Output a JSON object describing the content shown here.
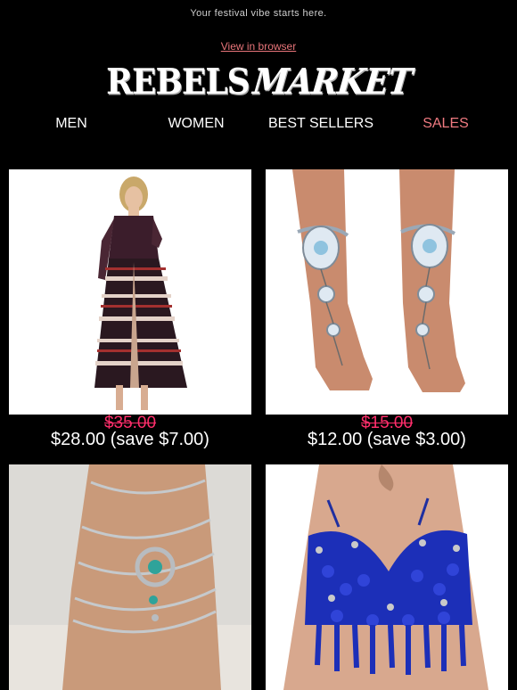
{
  "header": {
    "preheader": "Your festival vibe starts here.",
    "view_in_browser": "View in browser",
    "logo_left": "REBELS",
    "logo_right": "MARKET"
  },
  "nav": [
    {
      "label": "MEN"
    },
    {
      "label": "WOMEN"
    },
    {
      "label": "BEST SELLERS"
    },
    {
      "label": "SALES"
    }
  ],
  "products": [
    {
      "image": "maxi-dress-photo",
      "old_price": "$35.00",
      "new_price": "$28.00 (save $7.00)"
    },
    {
      "image": "jeweled-foot-chain-photo",
      "old_price": "$15.00",
      "new_price": "$12.00 (save $3.00)"
    },
    {
      "image": "silver-anklet-photo"
    },
    {
      "image": "blue-sequin-bra-top-photo"
    }
  ],
  "colors": {
    "background": "#000000",
    "link": "#e8757a",
    "sales": "#ef7a80",
    "strike_price": "#ff2e6b"
  }
}
